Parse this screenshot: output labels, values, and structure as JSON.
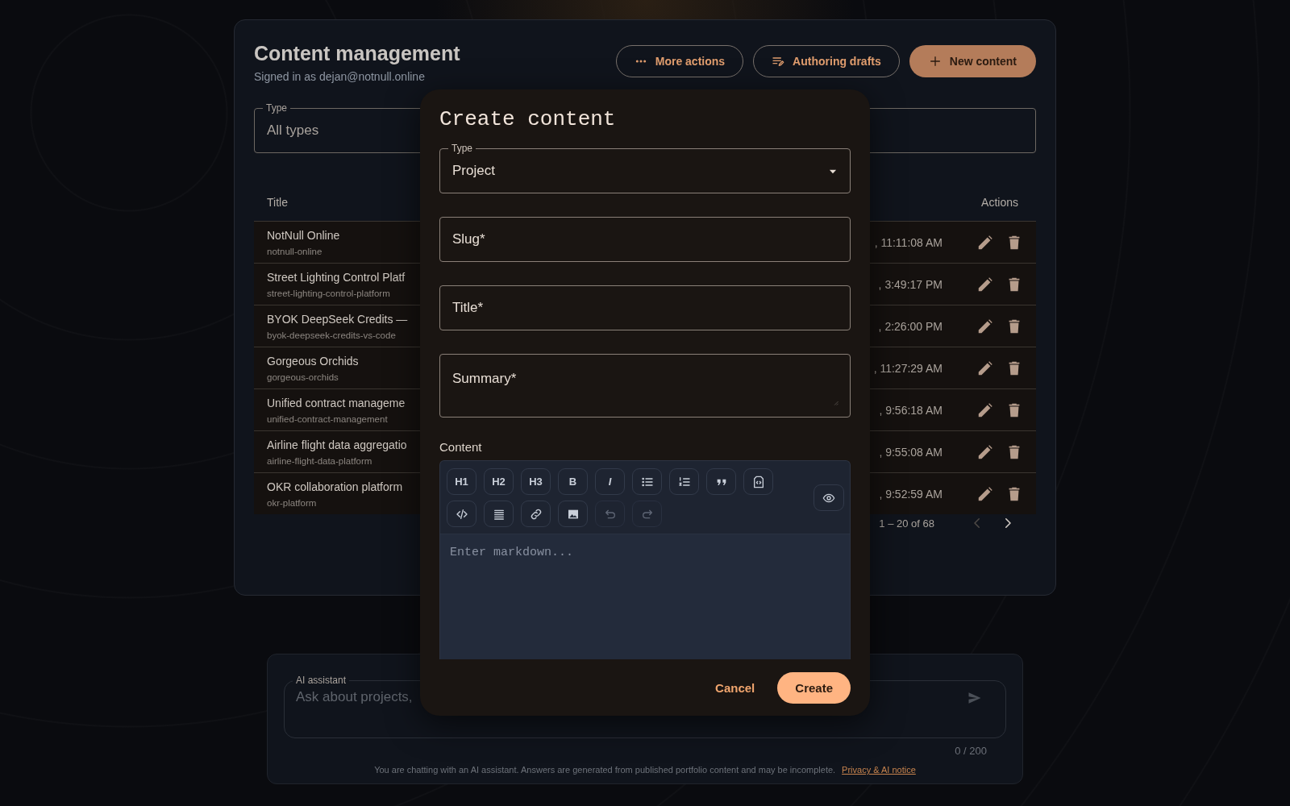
{
  "page": {
    "title": "Content management",
    "subtitle": "Signed in as dejan@notnull.online",
    "actions": [
      {
        "kind": "more",
        "label": "More actions"
      },
      {
        "kind": "drafts",
        "label": "Authoring drafts"
      },
      {
        "kind": "new",
        "label": "New content"
      }
    ]
  },
  "filter": {
    "label": "Type",
    "value": "All types"
  },
  "table": {
    "columns": [
      "Title",
      "Actions"
    ],
    "rows": [
      {
        "title": "NotNull Online",
        "slug": "notnull-online",
        "column_2": ", 11:11:08 AM"
      },
      {
        "title": "Street Lighting Control Platf",
        "slug": "street-lighting-control-platform",
        "column_2": ", 3:49:17 PM"
      },
      {
        "title": "BYOK DeepSeek Credits —",
        "slug": "byok-deepseek-credits-vs-code",
        "column_2": ", 2:26:00 PM"
      },
      {
        "title": "Gorgeous Orchids",
        "slug": "gorgeous-orchids",
        "column_2": ", 11:27:29 AM"
      },
      {
        "title": "Unified contract manageme",
        "slug": "unified-contract-management",
        "column_2": ", 9:56:18 AM"
      },
      {
        "title": "Airline flight data aggregatio",
        "slug": "airline-flight-data-platform",
        "column_2": ", 9:55:08 AM"
      },
      {
        "title": "OKR collaboration platform",
        "slug": "okr-platform",
        "column_2": ", 9:52:59 AM"
      }
    ]
  },
  "pagination": {
    "range": "1 – 20 of 68",
    "prev_disabled": true,
    "next_disabled": false
  },
  "assistant": {
    "label": "AI assistant",
    "placeholder": "Ask about projects,",
    "counter": "0 / 200",
    "notice": "You are chatting with an AI assistant. Answers are generated from published portfolio content and may be incomplete.",
    "link": "Privacy & AI notice"
  },
  "dialog": {
    "title": "Create content",
    "fields": [
      {
        "kind": "select",
        "label": "Type",
        "value": "Project"
      },
      {
        "kind": "text",
        "label": "Slug*"
      },
      {
        "kind": "text",
        "label": "Title*"
      },
      {
        "kind": "textarea",
        "label": "Summary*"
      }
    ],
    "content_label": "Content",
    "toolbar": [
      {
        "kind": "heading",
        "label": "H1",
        "disabled": false
      },
      {
        "kind": "heading",
        "label": "H2",
        "disabled": false
      },
      {
        "kind": "heading",
        "label": "H3",
        "disabled": false
      },
      {
        "kind": "bold",
        "label": "B",
        "disabled": false
      },
      {
        "kind": "italic",
        "label": "I",
        "disabled": false
      },
      {
        "kind": "bullets",
        "disabled": false
      },
      {
        "kind": "numbered",
        "disabled": false
      },
      {
        "kind": "quote",
        "disabled": false
      },
      {
        "kind": "embed",
        "disabled": false
      },
      {
        "kind": "code",
        "disabled": false
      },
      {
        "kind": "rule",
        "disabled": false
      },
      {
        "kind": "link",
        "disabled": false
      },
      {
        "kind": "image",
        "disabled": false
      },
      {
        "kind": "undo",
        "disabled": true
      },
      {
        "kind": "redo",
        "disabled": true
      }
    ],
    "editor_placeholder": "Enter markdown...",
    "buttons": [
      {
        "kind": "cancel",
        "label": "Cancel"
      },
      {
        "kind": "create",
        "label": "Create"
      }
    ]
  }
}
